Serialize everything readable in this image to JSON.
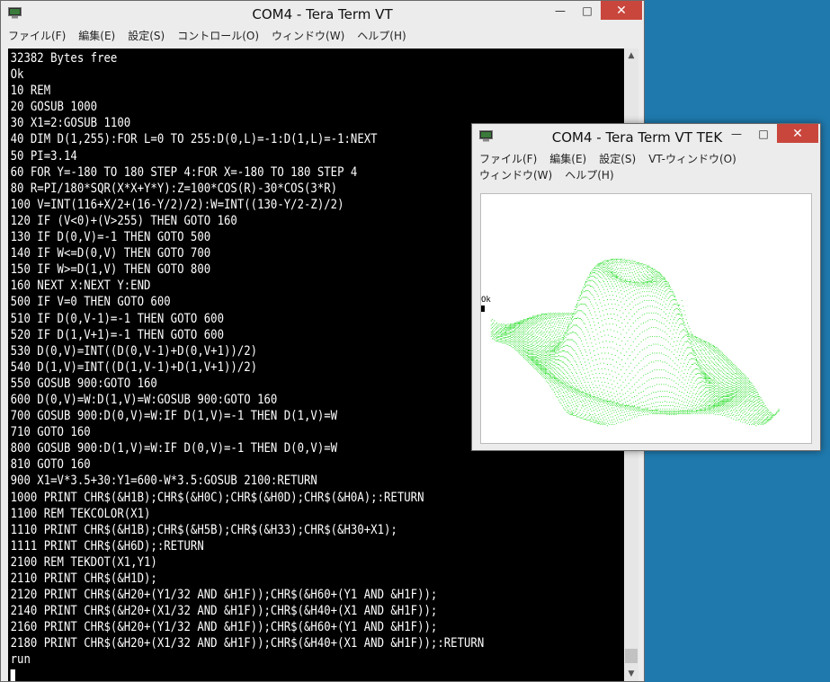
{
  "vt_window": {
    "title": "COM4 - Tera Term VT",
    "app_icon": "terminal-icon",
    "controls": {
      "minimize": "—",
      "maximize": "□",
      "close": "✕"
    },
    "menu": [
      "ファイル(F)",
      "編集(E)",
      "設定(S)",
      "コントロール(O)",
      "ウィンドウ(W)",
      "ヘルプ(H)"
    ],
    "terminal_lines": [
      "32382 Bytes free",
      "Ok",
      "10 REM",
      "20 GOSUB 1000",
      "30 X1=2:GOSUB 1100",
      "40 DIM D(1,255):FOR L=0 TO 255:D(0,L)=-1:D(1,L)=-1:NEXT",
      "50 PI=3.14",
      "60 FOR Y=-180 TO 180 STEP 4:FOR X=-180 TO 180 STEP 4",
      "80 R=PI/180*SQR(X*X+Y*Y):Z=100*COS(R)-30*COS(3*R)",
      "100 V=INT(116+X/2+(16-Y/2)/2):W=INT((130-Y/2-Z)/2)",
      "120 IF (V<0)+(V>255) THEN GOTO 160",
      "130 IF D(0,V)=-1 THEN GOTO 500",
      "140 IF W<=D(0,V) THEN GOTO 700",
      "150 IF W>=D(1,V) THEN GOTO 800",
      "160 NEXT X:NEXT Y:END",
      "500 IF V=0 THEN GOTO 600",
      "510 IF D(0,V-1)=-1 THEN GOTO 600",
      "520 IF D(1,V+1)=-1 THEN GOTO 600",
      "530 D(0,V)=INT((D(0,V-1)+D(0,V+1))/2)",
      "540 D(1,V)=INT((D(1,V-1)+D(1,V+1))/2)",
      "550 GOSUB 900:GOTO 160",
      "600 D(0,V)=W:D(1,V)=W:GOSUB 900:GOTO 160",
      "700 GOSUB 900:D(0,V)=W:IF D(1,V)=-1 THEN D(1,V)=W",
      "710 GOTO 160",
      "800 GOSUB 900:D(1,V)=W:IF D(0,V)=-1 THEN D(0,V)=W",
      "810 GOTO 160",
      "900 X1=V*3.5+30:Y1=600-W*3.5:GOSUB 2100:RETURN",
      "1000 PRINT CHR$(&H1B);CHR$(&H0C);CHR$(&H0D);CHR$(&H0A);:RETURN",
      "1100 REM TEKCOLOR(X1)",
      "1110 PRINT CHR$(&H1B);CHR$(&H5B);CHR$(&H33);CHR$(&H30+X1);",
      "1111 PRINT CHR$(&H6D);:RETURN",
      "2100 REM TEKDOT(X1,Y1)",
      "2110 PRINT CHR$(&H1D);",
      "2120 PRINT CHR$(&H20+(Y1/32 AND &H1F));CHR$(&H60+(Y1 AND &H1F));",
      "2140 PRINT CHR$(&H20+(X1/32 AND &H1F));CHR$(&H40+(X1 AND &H1F));",
      "2160 PRINT CHR$(&H20+(Y1/32 AND &H1F));CHR$(&H60+(Y1 AND &H1F));",
      "2180 PRINT CHR$(&H20+(X1/32 AND &H1F));CHR$(&H40+(X1 AND &H1F));:RETURN",
      "run"
    ]
  },
  "tek_window": {
    "title": "COM4 - Tera Term VT TEK",
    "app_icon": "terminal-icon",
    "controls": {
      "minimize": "—",
      "maximize": "□",
      "close": "✕"
    },
    "menu": [
      "ファイル(F)",
      "編集(E)",
      "設定(S)",
      "VT-ウィンドウ(O)",
      "ウィンドウ(W)",
      "ヘルプ(H)"
    ],
    "screen_text": "Ok",
    "plot_color": "#22dd22"
  },
  "colors": {
    "desktop": "#1f79ad",
    "close_button": "#c9463d",
    "terminal_bg": "#000000",
    "terminal_fg": "#ffffff"
  }
}
